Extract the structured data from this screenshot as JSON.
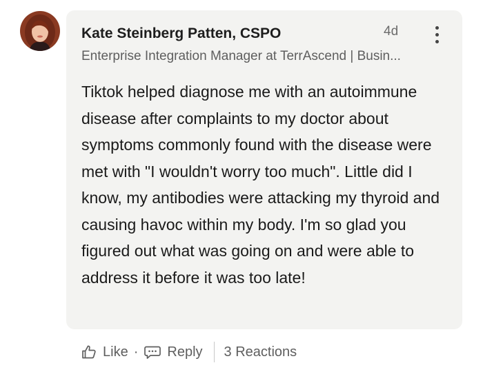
{
  "comment": {
    "author": {
      "name": "Kate Steinberg Patten, CSPO",
      "headline": "Enterprise Integration Manager at TerrAscend | Busin..."
    },
    "timestamp": "4d",
    "body": "Tiktok helped diagnose me with an autoimmune disease after complaints to my doctor about symptoms commonly found with the disease were met with \"I wouldn't worry too much\". Little did I know, my antibodies were attacking my thyroid and causing havoc within my body. I'm so glad you figured out what was going on and were able to address it before it was too late!"
  },
  "actions": {
    "like_label": "Like",
    "separator": "·",
    "reply_label": "Reply",
    "reactions_label": "3 Reactions"
  },
  "icons": {
    "like": "thumbs-up-icon",
    "reply": "speech-bubble-icon",
    "more": "more-vertical-icon"
  },
  "colors": {
    "bubble_bg": "#f3f3f1",
    "text": "#1a1a1a",
    "muted": "#5e5e5e"
  }
}
